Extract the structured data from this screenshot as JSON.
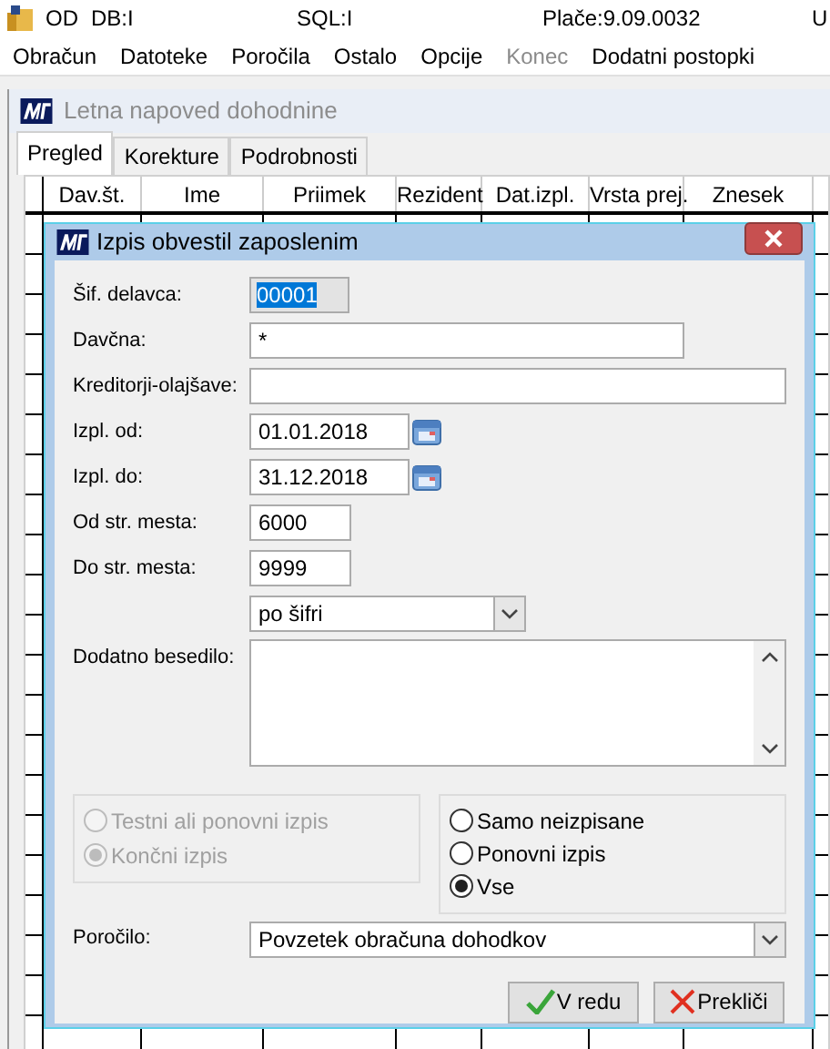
{
  "app_title_bar": {
    "items": [
      "OD",
      "DB:I",
      "SQL:I",
      "Plače:9.09.0032",
      "U"
    ]
  },
  "menu": [
    {
      "label": "Obračun",
      "disabled": false
    },
    {
      "label": "Datoteke",
      "disabled": false
    },
    {
      "label": "Poročila",
      "disabled": false
    },
    {
      "label": "Ostalo",
      "disabled": false
    },
    {
      "label": "Opcije",
      "disabled": false
    },
    {
      "label": "Konec",
      "disabled": true
    },
    {
      "label": "Dodatni postopki",
      "disabled": false
    }
  ],
  "child_window": {
    "title": "Letna napoved dohodnine",
    "tabs": [
      {
        "label": "Pregled",
        "selected": true
      },
      {
        "label": "Korekture",
        "selected": false
      },
      {
        "label": "Podrobnosti",
        "selected": false
      }
    ],
    "table": {
      "columns": [
        "Dav.št.",
        "Ime",
        "Priimek",
        "Rezident",
        "Dat.izpl.",
        "Vrsta prej.",
        "Znesek"
      ]
    }
  },
  "dialog": {
    "title": "Izpis obvestil zaposlenim",
    "fields": [
      {
        "kind": "code",
        "label": "Šif. delavca:",
        "value": "00001"
      },
      {
        "kind": "text",
        "label": "Davčna:",
        "value": "*"
      },
      {
        "kind": "wide",
        "label": "Kreditorji-olajšave:"
      },
      {
        "kind": "date",
        "label": "Izpl. od:",
        "value": "01.01.2018"
      },
      {
        "kind": "date",
        "label": "Izpl. do:",
        "value": "31.12.2018"
      },
      {
        "kind": "short",
        "label": "Od str. mesta:",
        "value": "6000"
      },
      {
        "kind": "short",
        "label": "Do str. mesta:",
        "value": "9999"
      },
      {
        "kind": "select",
        "value": "po šifri"
      },
      {
        "kind": "textarea",
        "label": "Dodatno besedilo:"
      }
    ],
    "option_groups": [
      {
        "disabled": true,
        "options": [
          {
            "label": "Testni ali ponovni izpis",
            "selected": false
          },
          {
            "label": "Končni izpis",
            "selected": true
          }
        ]
      },
      {
        "disabled": false,
        "options": [
          {
            "label": "Samo neizpisane",
            "selected": false
          },
          {
            "label": "Ponovni izpis",
            "selected": false
          },
          {
            "label": "Vse",
            "selected": true
          }
        ]
      }
    ],
    "report": {
      "label": "Poročilo:",
      "value": "Povzetek obračuna dohodkov"
    },
    "buttons": [
      {
        "kind": "ok",
        "label": "V redu"
      },
      {
        "kind": "cancel",
        "label": "Prekliči"
      }
    ]
  }
}
